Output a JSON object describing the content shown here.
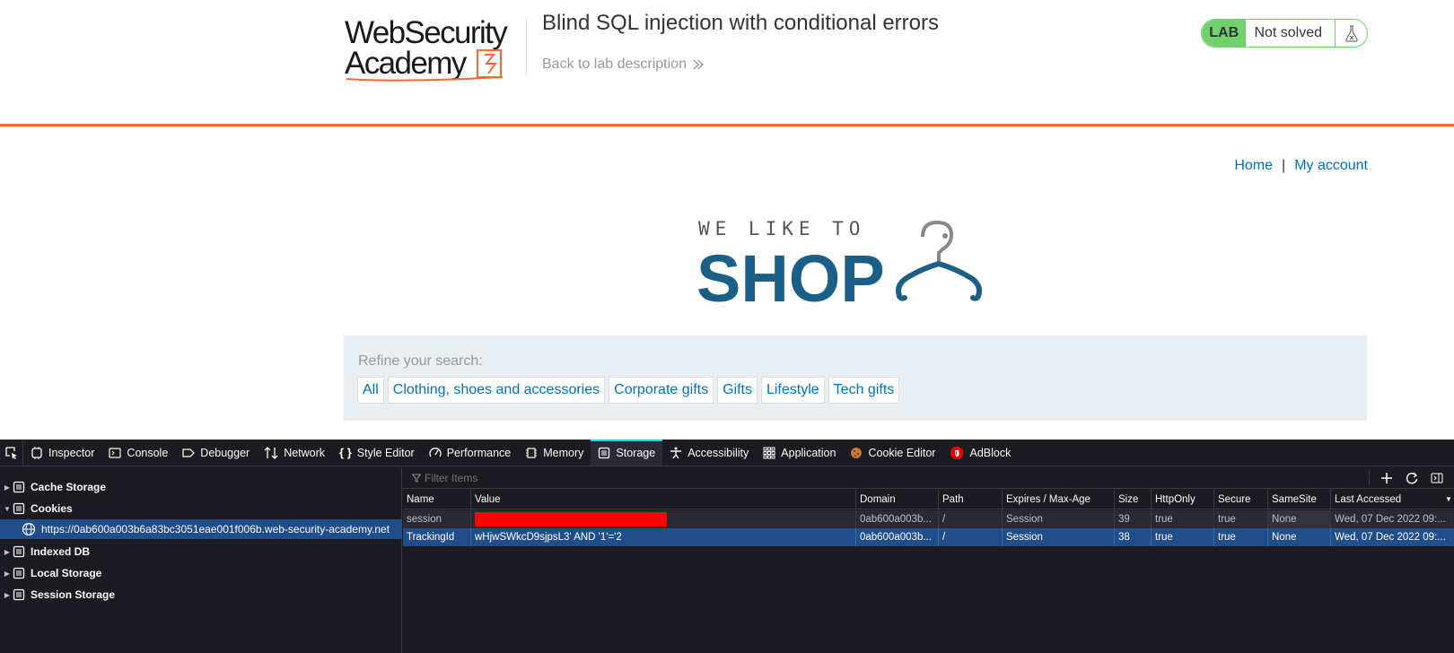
{
  "header": {
    "logo_line1": "WebSecurity",
    "logo_line2": "Academy",
    "lab_title": "Blind SQL injection with conditional errors",
    "back_link": "Back to lab description",
    "lab_badge": "LAB",
    "lab_status": "Not solved",
    "accent_color": "#ff6633",
    "status_color": "#70d16d"
  },
  "nav": {
    "home": "Home",
    "separator": "|",
    "account": "My account"
  },
  "shop_logo": {
    "line1": "WE LIKE TO",
    "line2": "SHOP",
    "color": "#1b5f86"
  },
  "filter": {
    "label": "Refine your search:",
    "categories": [
      "All",
      "Clothing, shoes and accessories",
      "Corporate gifts",
      "Gifts",
      "Lifestyle",
      "Tech gifts"
    ]
  },
  "devtools": {
    "tabs": [
      {
        "label": "Inspector",
        "icon": "inspector-icon"
      },
      {
        "label": "Console",
        "icon": "console-icon"
      },
      {
        "label": "Debugger",
        "icon": "debugger-icon"
      },
      {
        "label": "Network",
        "icon": "network-icon"
      },
      {
        "label": "Style Editor",
        "icon": "style-editor-icon"
      },
      {
        "label": "Performance",
        "icon": "performance-icon"
      },
      {
        "label": "Memory",
        "icon": "memory-icon"
      },
      {
        "label": "Storage",
        "icon": "storage-icon",
        "selected": true
      },
      {
        "label": "Accessibility",
        "icon": "accessibility-icon"
      },
      {
        "label": "Application",
        "icon": "application-icon"
      },
      {
        "label": "Cookie Editor",
        "icon": "cookie-icon"
      },
      {
        "label": "AdBlock",
        "icon": "adblock-icon"
      }
    ],
    "sidebar": {
      "cache_storage": "Cache Storage",
      "cookies": "Cookies",
      "cookie_origin": "https://0ab600a003b6a83bc3051eae001f006b.web-security-academy.net",
      "indexed_db": "Indexed DB",
      "local_storage": "Local Storage",
      "session_storage": "Session Storage"
    },
    "filter_placeholder": "Filter Items",
    "columns": [
      "Name",
      "Value",
      "Domain",
      "Path",
      "Expires / Max-Age",
      "Size",
      "HttpOnly",
      "Secure",
      "SameSite",
      "Last Accessed"
    ],
    "rows": [
      {
        "name": "session",
        "value": "",
        "domain": "0ab600a003b...",
        "path": "/",
        "expires": "Session",
        "size": "39",
        "httponly": "true",
        "secure": "true",
        "samesite": "None",
        "last_accessed": "Wed, 07 Dec 2022 09:..."
      },
      {
        "name": "TrackingId",
        "value": "wHjwSWkcD9sjpsL3' AND '1'='2",
        "domain": "0ab600a003b...",
        "path": "/",
        "expires": "Session",
        "size": "38",
        "httponly": "true",
        "secure": "true",
        "samesite": "None",
        "last_accessed": "Wed, 07 Dec 2022 09:..."
      }
    ]
  }
}
